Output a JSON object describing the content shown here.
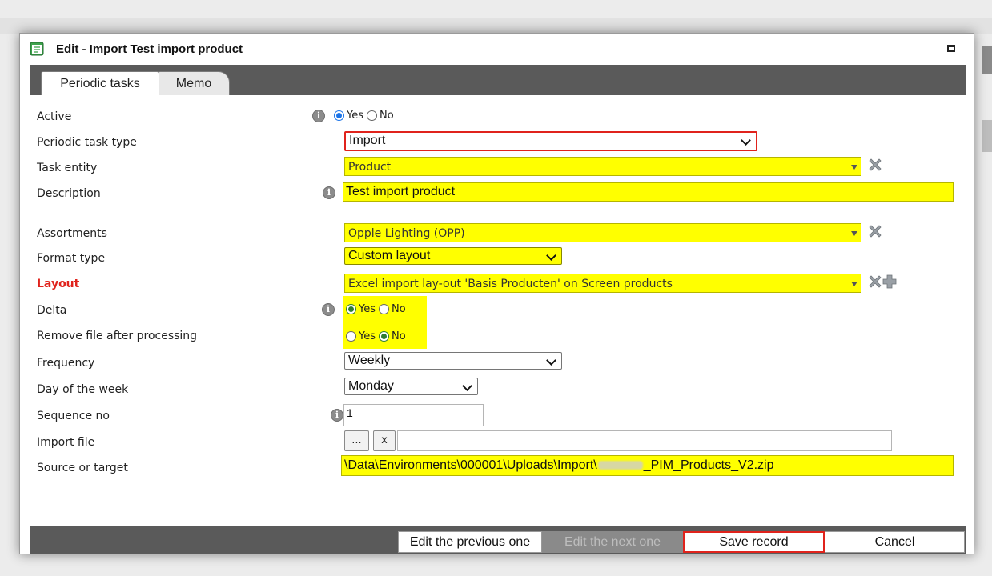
{
  "dialog": {
    "title": "Edit - Import Test import product"
  },
  "tabs": [
    {
      "label": "Periodic tasks",
      "active": true
    },
    {
      "label": "Memo",
      "active": false
    }
  ],
  "labels": {
    "active": "Active",
    "periodic_task_type": "Periodic task type",
    "task_entity": "Task entity",
    "description": "Description",
    "assortments": "Assortments",
    "format_type": "Format type",
    "layout": "Layout",
    "delta": "Delta",
    "remove_file": "Remove file after processing",
    "frequency": "Frequency",
    "day_of_week": "Day of the week",
    "sequence_no": "Sequence no",
    "import_file": "Import file",
    "source_target": "Source or target"
  },
  "fields": {
    "active": {
      "yes": "Yes",
      "no": "No",
      "selected": "Yes"
    },
    "periodic_task_type": "Import",
    "task_entity": "Product",
    "description": "Test import product",
    "assortments": "Opple Lighting (OPP)",
    "format_type": "Custom layout",
    "layout": "Excel import lay-out 'Basis Producten' on Screen products",
    "delta": {
      "yes": "Yes",
      "no": "No",
      "selected": "Yes"
    },
    "remove_file": {
      "yes": "Yes",
      "no": "No",
      "selected": "No"
    },
    "frequency": "Weekly",
    "day_of_week": "Monday",
    "sequence_no": "1",
    "import_file": {
      "browse_label": "...",
      "clear_label": "x",
      "value": ""
    },
    "source_target": {
      "prefix": "\\Data\\Environments\\000001\\Uploads\\Import\\",
      "suffix": "_PIM_Products_V2.zip"
    }
  },
  "footer": {
    "prev_label": "Edit the previous one",
    "next_label": "Edit the next one",
    "save_label": "Save record",
    "cancel_label": "Cancel"
  },
  "colors": {
    "highlight": "#ffff00",
    "required_label": "#e0231c",
    "frame_red": "#e0231c",
    "bar_gray": "#5a5a5a"
  }
}
